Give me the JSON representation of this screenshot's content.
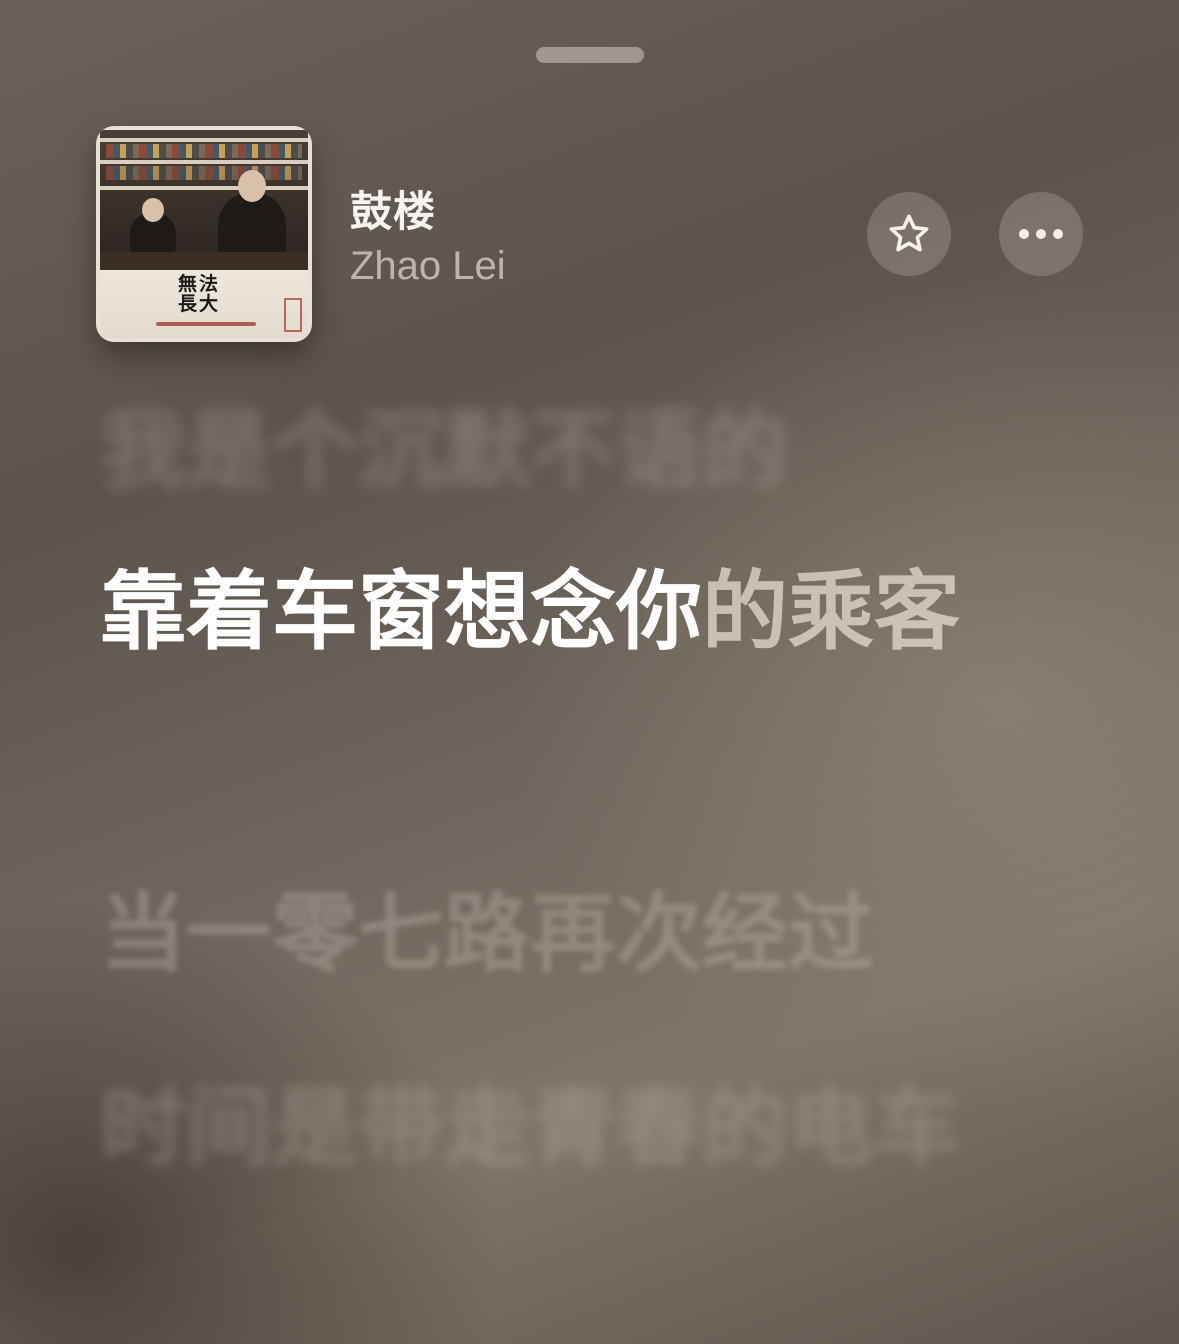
{
  "sheet": {
    "grabber": "grabber-handle"
  },
  "now_playing": {
    "song_title": "鼓楼",
    "artist": "Zhao Lei",
    "artwork": {
      "title_text": "無法長大"
    },
    "favorite_icon": "star-icon",
    "more_icon": "ellipsis-icon"
  },
  "lyrics": {
    "previous_line": "我是个沉默不语的",
    "current_line": {
      "sung": "靠着车窗想念你",
      "unsung": "的乘客"
    },
    "next_lines": [
      "当一零七路再次经过",
      "时间是带走青春的电车"
    ]
  }
}
